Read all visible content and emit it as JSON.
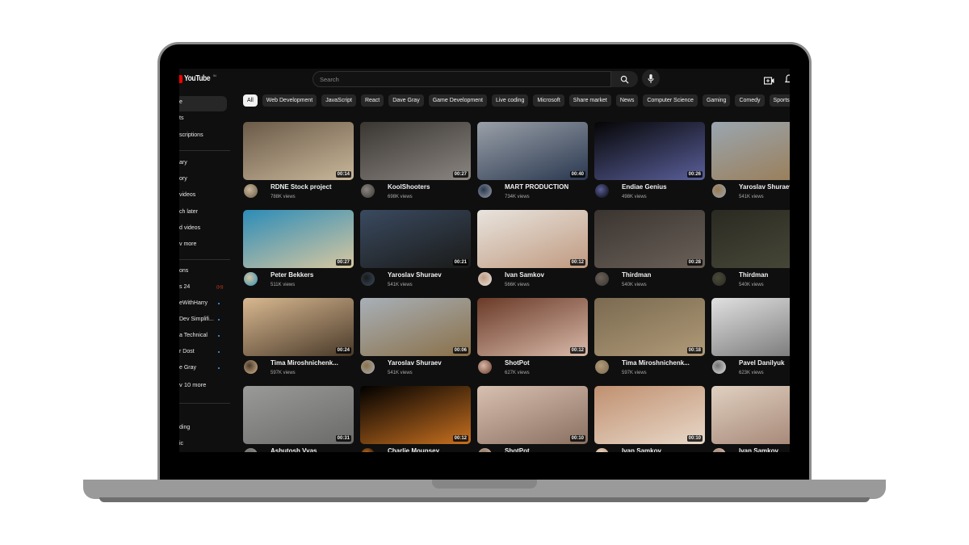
{
  "header": {
    "logo_text": "YouTube",
    "logo_region": "IN",
    "search_placeholder": "Search",
    "brand_color": "#ff0000"
  },
  "chips": [
    "All",
    "Web Development",
    "JavaScript",
    "React",
    "Dave Gray",
    "Game Development",
    "Live coding",
    "Microsoft",
    "Share market",
    "News",
    "Computer Science",
    "Gaming",
    "Comedy",
    "Sports entertain"
  ],
  "sidebar": {
    "items": [
      "e",
      "ts",
      "scriptions",
      "ary",
      "ory",
      "videos",
      "ch later",
      "d videos",
      "v more"
    ],
    "section_title": "ons",
    "subscriptions": [
      {
        "label": "s 24",
        "status": "live"
      },
      {
        "label": "eWithHarry",
        "status": "new"
      },
      {
        "label": "Dev Simplifi...",
        "status": "new"
      },
      {
        "label": "a Technical",
        "status": "new"
      },
      {
        "label": "r Dost",
        "status": "new"
      },
      {
        "label": "e Gray",
        "status": "new"
      }
    ],
    "show_more": "v 10 more",
    "explore": [
      "ding",
      "ic"
    ]
  },
  "videos": [
    {
      "channel": "RDNE Stock project",
      "views": "788K views",
      "duration": "00:14",
      "colors": [
        "#6b5a48",
        "#c9b79a"
      ]
    },
    {
      "channel": "KoolShooters",
      "views": "698K views",
      "duration": "00:27",
      "colors": [
        "#3a3632",
        "#8a8580"
      ]
    },
    {
      "channel": "MART PRODUCTION",
      "views": "734K views",
      "duration": "00:40",
      "colors": [
        "#9aa0a8",
        "#2a3850"
      ]
    },
    {
      "channel": "Endiae Genius",
      "views": "498K views",
      "duration": "00:26",
      "colors": [
        "#050505",
        "#5a5f9a"
      ]
    },
    {
      "channel": "Yaroslav Shuraev",
      "views": "541K views",
      "duration": "",
      "colors": [
        "#9aa6b0",
        "#9a7a50"
      ]
    },
    {
      "channel": "Peter Bekkers",
      "views": "511K views",
      "duration": "00:27",
      "colors": [
        "#2c8cb8",
        "#d8c8a0"
      ]
    },
    {
      "channel": "Yaroslav Shuraev",
      "views": "541K views",
      "duration": "00:21",
      "colors": [
        "#3a4a60",
        "#1a1a18"
      ]
    },
    {
      "channel": "Ivan Samkov",
      "views": "566K views",
      "duration": "00:12",
      "colors": [
        "#e8e4de",
        "#c09a80"
      ]
    },
    {
      "channel": "Thirdman",
      "views": "540K views",
      "duration": "00:28",
      "colors": [
        "#3a3430",
        "#6a6058"
      ]
    },
    {
      "channel": "Thirdman",
      "views": "540K views",
      "duration": "",
      "colors": [
        "#2a2a22",
        "#4a4a3a"
      ]
    },
    {
      "channel": "Tima Miroshnichenk...",
      "views": "597K views",
      "duration": "00:24",
      "colors": [
        "#d8b890",
        "#4a3a2a"
      ]
    },
    {
      "channel": "Yaroslav Shuraev",
      "views": "541K views",
      "duration": "00:06",
      "colors": [
        "#a8b0b8",
        "#8a7048"
      ]
    },
    {
      "channel": "ShotPot",
      "views": "627K views",
      "duration": "00:12",
      "colors": [
        "#6a3a28",
        "#d8b8a8"
      ]
    },
    {
      "channel": "Tima Miroshnichenk...",
      "views": "597K views",
      "duration": "00:18",
      "colors": [
        "#7a6a50",
        "#b09a78"
      ]
    },
    {
      "channel": "Pavel Danilyuk",
      "views": "623K views",
      "duration": "",
      "colors": [
        "#e0e0e0",
        "#707070"
      ]
    },
    {
      "channel": "Ashutosh Vyas",
      "views": "",
      "duration": "00:31",
      "colors": [
        "#9a9a98",
        "#6a6a68"
      ]
    },
    {
      "channel": "Charlie Mounsey",
      "views": "",
      "duration": "00:12",
      "colors": [
        "#000000",
        "#c87020"
      ]
    },
    {
      "channel": "ShotPot",
      "views": "",
      "duration": "00:10",
      "colors": [
        "#d8c0b0",
        "#8a7060"
      ]
    },
    {
      "channel": "Ivan Samkov",
      "views": "",
      "duration": "00:10",
      "colors": [
        "#c09070",
        "#e8d8c8"
      ]
    },
    {
      "channel": "Ivan Samkov",
      "views": "",
      "duration": "",
      "colors": [
        "#e0d0c0",
        "#a08070"
      ]
    }
  ]
}
